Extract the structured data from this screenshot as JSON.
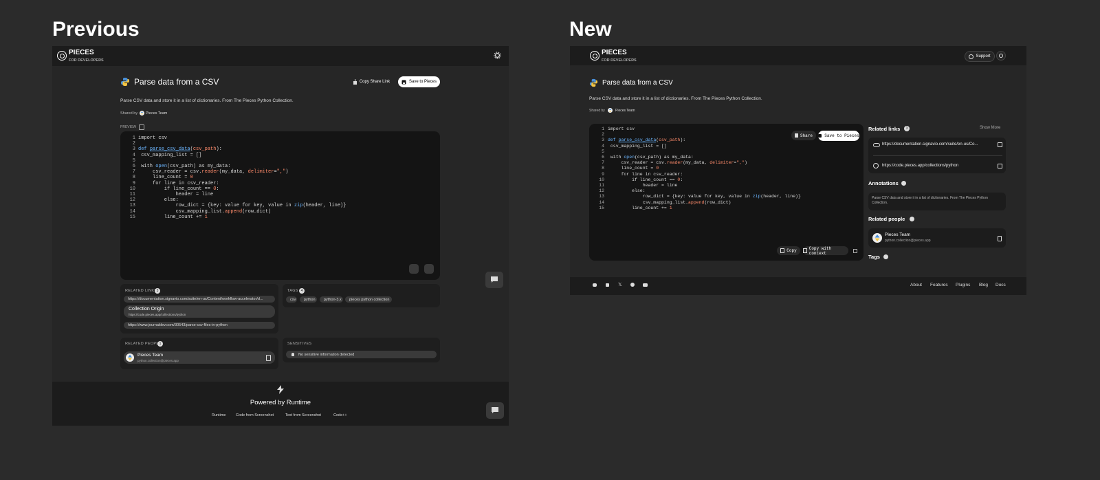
{
  "headings": {
    "previous": "Previous",
    "new": "New"
  },
  "brand": {
    "name": "PIECES",
    "sub": "FOR DEVELOPERS"
  },
  "snippet": {
    "title": "Parse data from a CSV",
    "description": "Parse CSV data and store it in a list of dictionaries. From The Pieces Python Collection.",
    "shared_by_label": "Shared by",
    "shared_by_name": "Pieces Team"
  },
  "code_lines": [
    "1",
    "2",
    "3",
    "4",
    "5",
    "6",
    "7",
    "8",
    "9",
    "10",
    "11",
    "12",
    "13",
    "14",
    "15"
  ],
  "previous": {
    "copy_share_link": "Copy Share Link",
    "save_to_pieces": "Save to Pieces",
    "preview_label": "PREVIEW",
    "related_links_label": "RELATED LINKS",
    "related_links_count": "3",
    "links": [
      "https://documentation.signavio.com/suite/en-us/Content/workflow-accelerator/d...",
      "https://www.journaldev.com/30543/parse-csv-files-in-python"
    ],
    "collection_origin": {
      "title": "Collection Origin",
      "url": "https://code.pieces.app/collections/python"
    },
    "tags_label": "TAGS",
    "tags_count": "4",
    "tags": [
      "csv",
      "python",
      "python-3.x",
      "pieces python collection"
    ],
    "related_people_label": "RELATED PEOPLE",
    "related_people_count": "1",
    "person": {
      "name": "Pieces Team",
      "email": "python.collection@pieces.app"
    },
    "sensitives_label": "SENSITIVES",
    "sensitive_text": "No sensitive information detected",
    "powered_by": "Powered by Runtime",
    "footer_links": [
      "Runtime",
      "Code from Screenshot",
      "Text from Screenshot",
      "Code++"
    ]
  },
  "new": {
    "support": "Support",
    "share": "Share",
    "save_to_pieces": "Save to Pieces",
    "copy": "Copy",
    "copy_with_context": "Copy with context",
    "related_links_label": "Related links",
    "related_links_count": "3",
    "show_more": "Show More",
    "links": [
      "https://documentation.signavio.com/suite/en-us/Co...",
      "https://code.pieces.app/collections/python"
    ],
    "annotations_label": "Annotations",
    "annotation_text": "Parse CSV data and store it in a list of dictionaries. From The Pieces Python Collection.",
    "related_people_label": "Related people",
    "person": {
      "name": "Pieces Team",
      "email": "python.collection@pieces.app"
    },
    "tags_label": "Tags",
    "footer_links": [
      "About",
      "Features",
      "Plugins",
      "Blog",
      "Docs"
    ],
    "social_icons": [
      "discord-icon",
      "linkedin-icon",
      "x-icon",
      "github-icon",
      "youtube-icon"
    ]
  }
}
